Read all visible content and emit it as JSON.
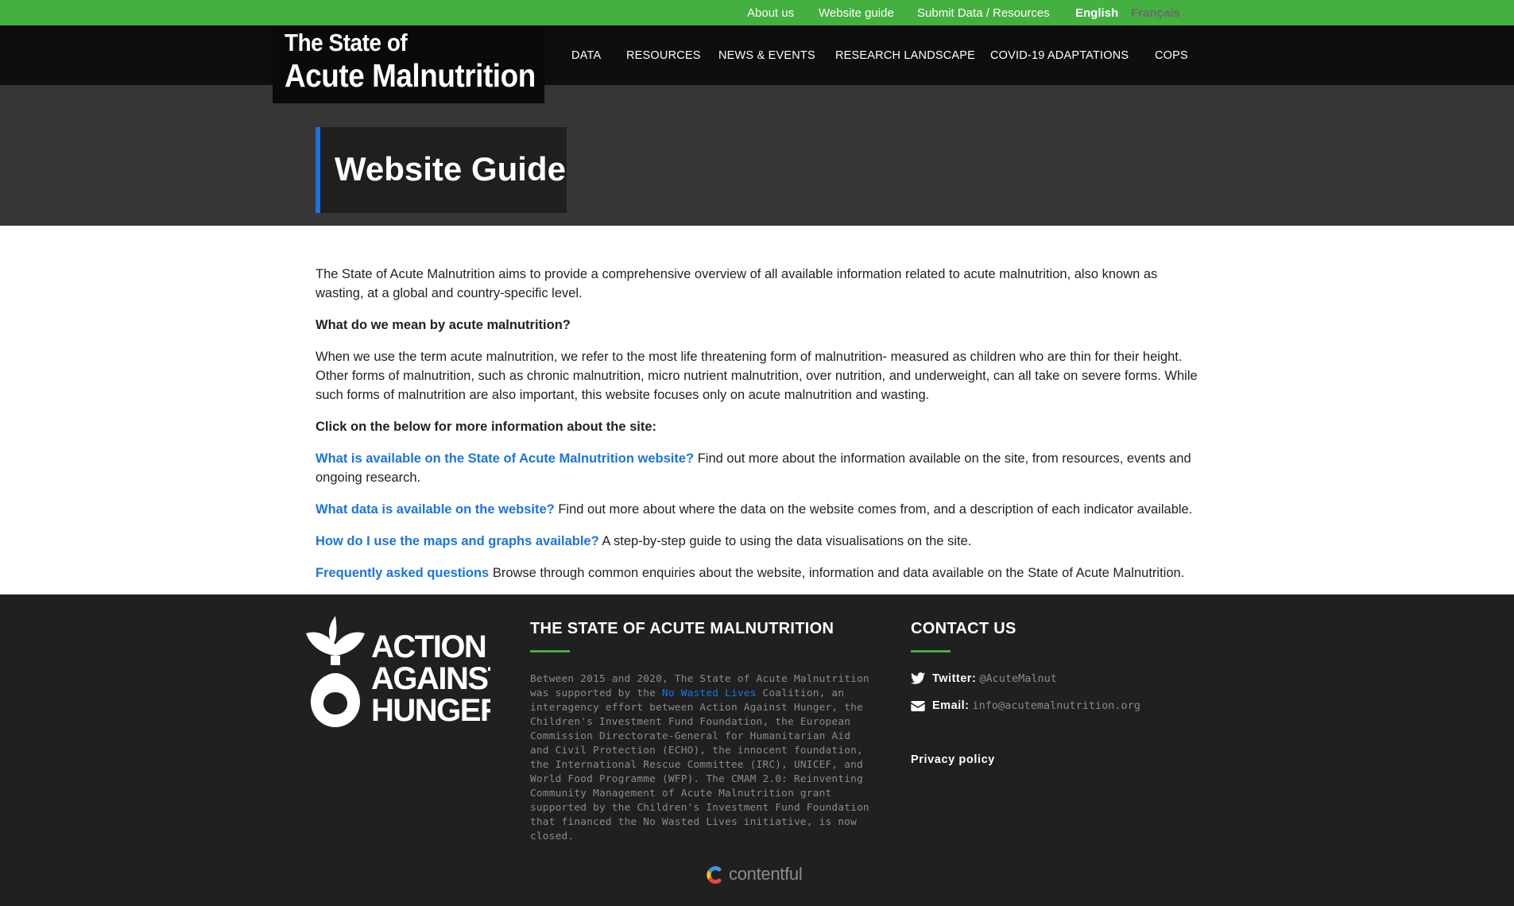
{
  "topbar": {
    "links": [
      "About us",
      "Website guide",
      "Submit Data / Resources"
    ],
    "lang_en": "English",
    "lang_fr": "Français"
  },
  "logo": {
    "line1": "The State of",
    "line2": "Acute Malnutrition"
  },
  "nav": {
    "items": [
      "DATA",
      "RESOURCES",
      "NEWS & EVENTS",
      "RESEARCH LANDSCAPE",
      "COVID-19 ADAPTATIONS",
      "COPS"
    ]
  },
  "hero": {
    "title": "Website Guide"
  },
  "content": {
    "intro": "The State of Acute Malnutrition aims to provide a comprehensive overview of all available information related to acute malnutrition, also known as wasting, at a global and country-specific level.",
    "q_heading": "What do we mean by acute malnutrition?",
    "definition": "When we use the term acute malnutrition, we refer to the most life threatening form of malnutrition- measured as children who are thin for their height. Other forms of malnutrition, such as chronic malnutrition, micro nutrient malnutrition, over nutrition, and underweight, can all take on severe forms. While such forms of malnutrition are also important, this website focuses only on acute malnutrition and wasting.",
    "click_heading": "Click on the below for more information about the site:",
    "guide_links": [
      {
        "link": "What is available on the State of Acute Malnutrition website?",
        "text": " Find out more about the information available on the site, from resources, events and ongoing research."
      },
      {
        "link": "What data is available on the website?",
        "text": " Find out more about where the data on the website comes from, and a description of each indicator available."
      },
      {
        "link": "How do I use the maps and graphs available?",
        "text": " A step-by-step guide to using the data visualisations on the site."
      },
      {
        "link": "Frequently asked questions",
        "text": " Browse through common enquiries about the website, information and data available on the State of Acute Malnutrition."
      }
    ]
  },
  "footer": {
    "aah_logo_text": [
      "ACTION",
      "AGAINST",
      "HUNGER"
    ],
    "about_heading": "THE STATE OF ACUTE MALNUTRITION",
    "about_text_before": "Between 2015 and 2020, The State of Acute Malnutrition was supported by the ",
    "about_link": "No Wasted Lives",
    "about_text_after": " Coalition, an interagency effort between Action Against Hunger, the Children's Investment Fund Foundation, the European Commission Directorate-General for Humanitarian Aid and Civil Protection (ECHO), the innocent foundation, the International Rescue Committee (IRC), UNICEF, and World Food Programme (WFP). The CMAM 2.0: Reinventing Community Management of Acute Malnutrition grant supported by the Children's Investment Fund Foundation that financed the No Wasted Lives initiative, is now closed.",
    "contact_heading": "CONTACT US",
    "twitter_label": "Twitter:",
    "twitter_value": "@AcuteMalnut",
    "email_label": "Email:",
    "email_value": "info@acutemalnutrition.org",
    "privacy": "Privacy policy",
    "cms_brand": "contentful"
  },
  "colors": {
    "topbar": "#44b040",
    "nav": "#0e0e0e",
    "hero": "#363636",
    "accent_link": "#1a74e0",
    "footer": "#202020"
  }
}
